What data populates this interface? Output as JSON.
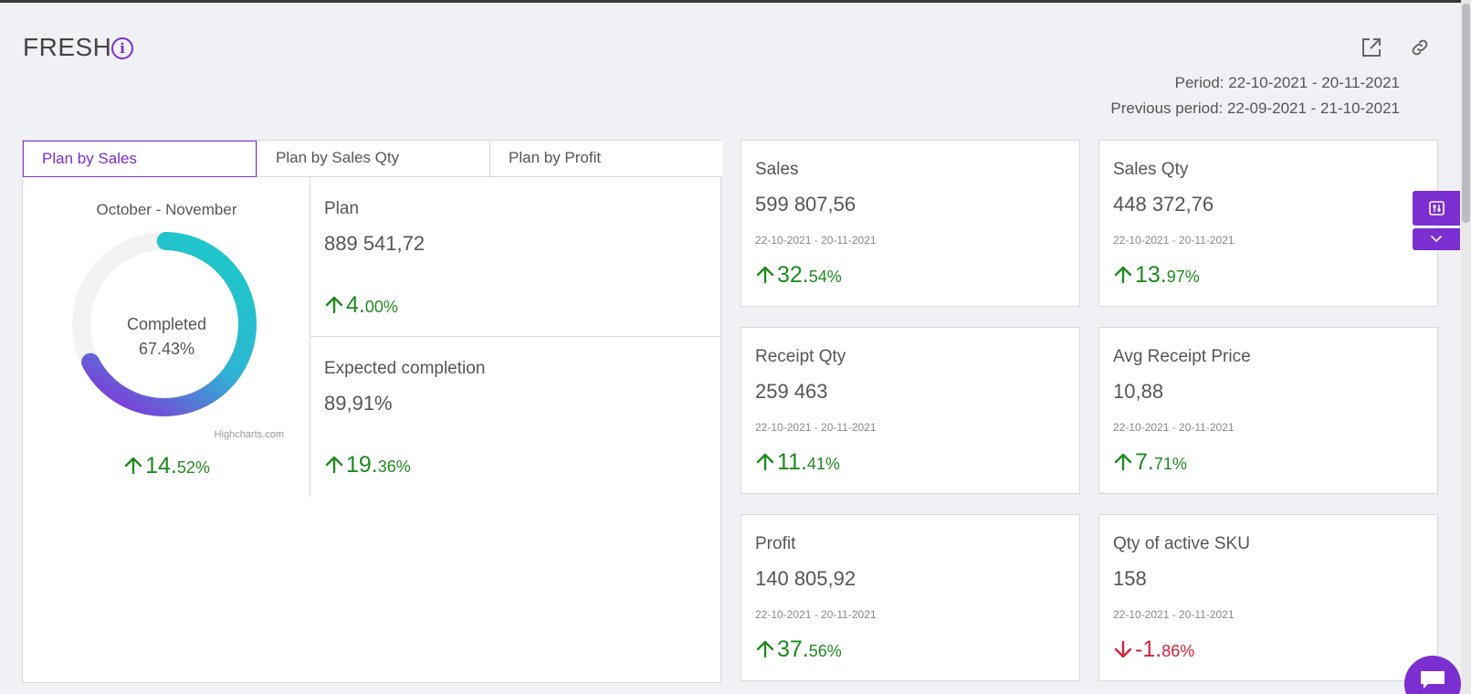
{
  "header": {
    "title": "FRESH",
    "period": "Period: 22-10-2021 - 20-11-2021",
    "previous_period": "Previous period: 22-09-2021 - 21-10-2021"
  },
  "tabs": [
    {
      "label": "Plan by Sales",
      "active": true
    },
    {
      "label": "Plan by Sales Qty",
      "active": false
    },
    {
      "label": "Plan by Profit",
      "active": false
    }
  ],
  "donut": {
    "period_label": "October - November",
    "center_label": "Completed",
    "center_value": "67.43%",
    "completed_fraction": 0.6743,
    "credit": "Highcharts.com",
    "change": {
      "direction": "up",
      "int": "14.",
      "dec": "52%"
    }
  },
  "plan": {
    "label": "Plan",
    "value": "889 541,72",
    "change": {
      "direction": "up",
      "int": "4.",
      "dec": "00%"
    }
  },
  "expected": {
    "label": "Expected completion",
    "value": "89,91%",
    "change": {
      "direction": "up",
      "int": "19.",
      "dec": "36%"
    }
  },
  "cards": [
    {
      "label": "Sales",
      "value": "599 807,56",
      "period": "22-10-2021 - 20-11-2021",
      "change": {
        "direction": "up",
        "int": "32.",
        "dec": "54%"
      }
    },
    {
      "label": "Sales Qty",
      "value": "448 372,76",
      "period": "22-10-2021 - 20-11-2021",
      "change": {
        "direction": "up",
        "int": "13.",
        "dec": "97%"
      }
    },
    {
      "label": "Receipt Qty",
      "value": "259 463",
      "period": "22-10-2021 - 20-11-2021",
      "change": {
        "direction": "up",
        "int": "11.",
        "dec": "41%"
      }
    },
    {
      "label": "Avg Receipt Price",
      "value": "10,88",
      "period": "22-10-2021 - 20-11-2021",
      "change": {
        "direction": "up",
        "int": "7.",
        "dec": "71%"
      }
    },
    {
      "label": "Profit",
      "value": "140 805,92",
      "period": "22-10-2021 - 20-11-2021",
      "change": {
        "direction": "up",
        "int": "37.",
        "dec": "56%"
      }
    },
    {
      "label": "Qty of active SKU",
      "value": "158",
      "period": "22-10-2021 - 20-11-2021",
      "change": {
        "direction": "down",
        "int": "-1.",
        "dec": "86%"
      }
    }
  ],
  "colors": {
    "accent": "#7b2fd0",
    "up": "#1f8a1f",
    "down": "#d0223a",
    "donut_start": "#1ec8c8",
    "donut_end": "#7b3fd8",
    "donut_track": "#f3f3f3"
  },
  "icons": {
    "info": "info-icon",
    "open": "external-link-icon",
    "link": "link-icon",
    "filter": "sliders-icon",
    "collapse": "chevron-down-icon",
    "chat": "chat-icon"
  }
}
